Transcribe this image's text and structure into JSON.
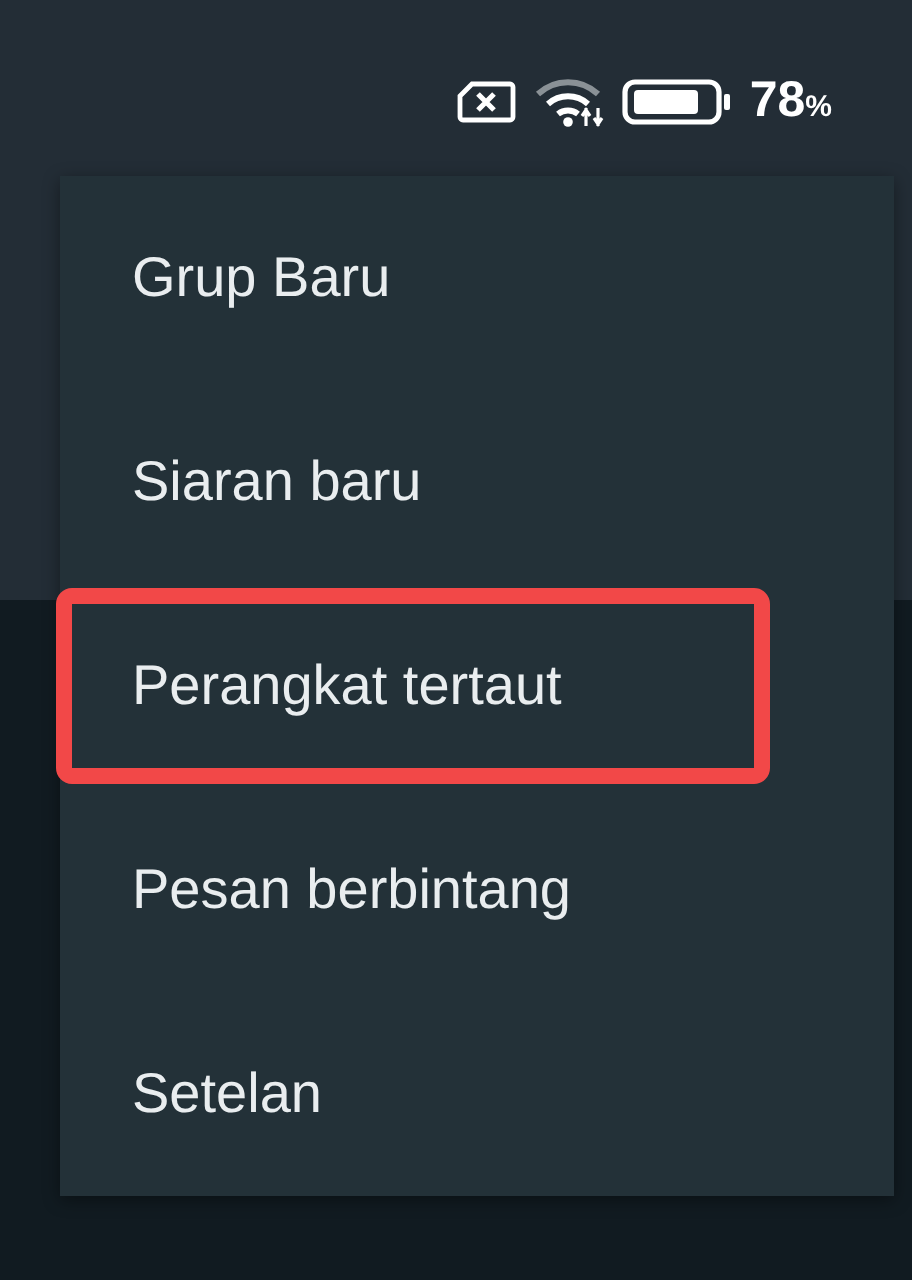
{
  "status_bar": {
    "battery_text": "78",
    "battery_unit": "%"
  },
  "menu": {
    "items": [
      {
        "label": "Grup Baru",
        "highlighted": false
      },
      {
        "label": "Siaran baru",
        "highlighted": false
      },
      {
        "label": "Perangkat tertaut",
        "highlighted": true
      },
      {
        "label": "Pesan berbintang",
        "highlighted": false
      },
      {
        "label": "Setelan",
        "highlighted": false
      }
    ]
  }
}
